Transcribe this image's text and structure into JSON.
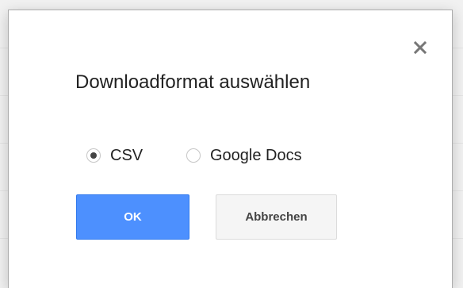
{
  "dialog": {
    "title": "Downloadformat auswählen",
    "close_icon": "close-icon",
    "options": [
      {
        "label": "CSV",
        "checked": true
      },
      {
        "label": "Google Docs",
        "checked": false
      }
    ],
    "ok_label": "OK",
    "cancel_label": "Abbrechen"
  },
  "colors": {
    "primary_button": "#4d90fe",
    "secondary_button": "#f5f5f5",
    "text": "#222222"
  }
}
